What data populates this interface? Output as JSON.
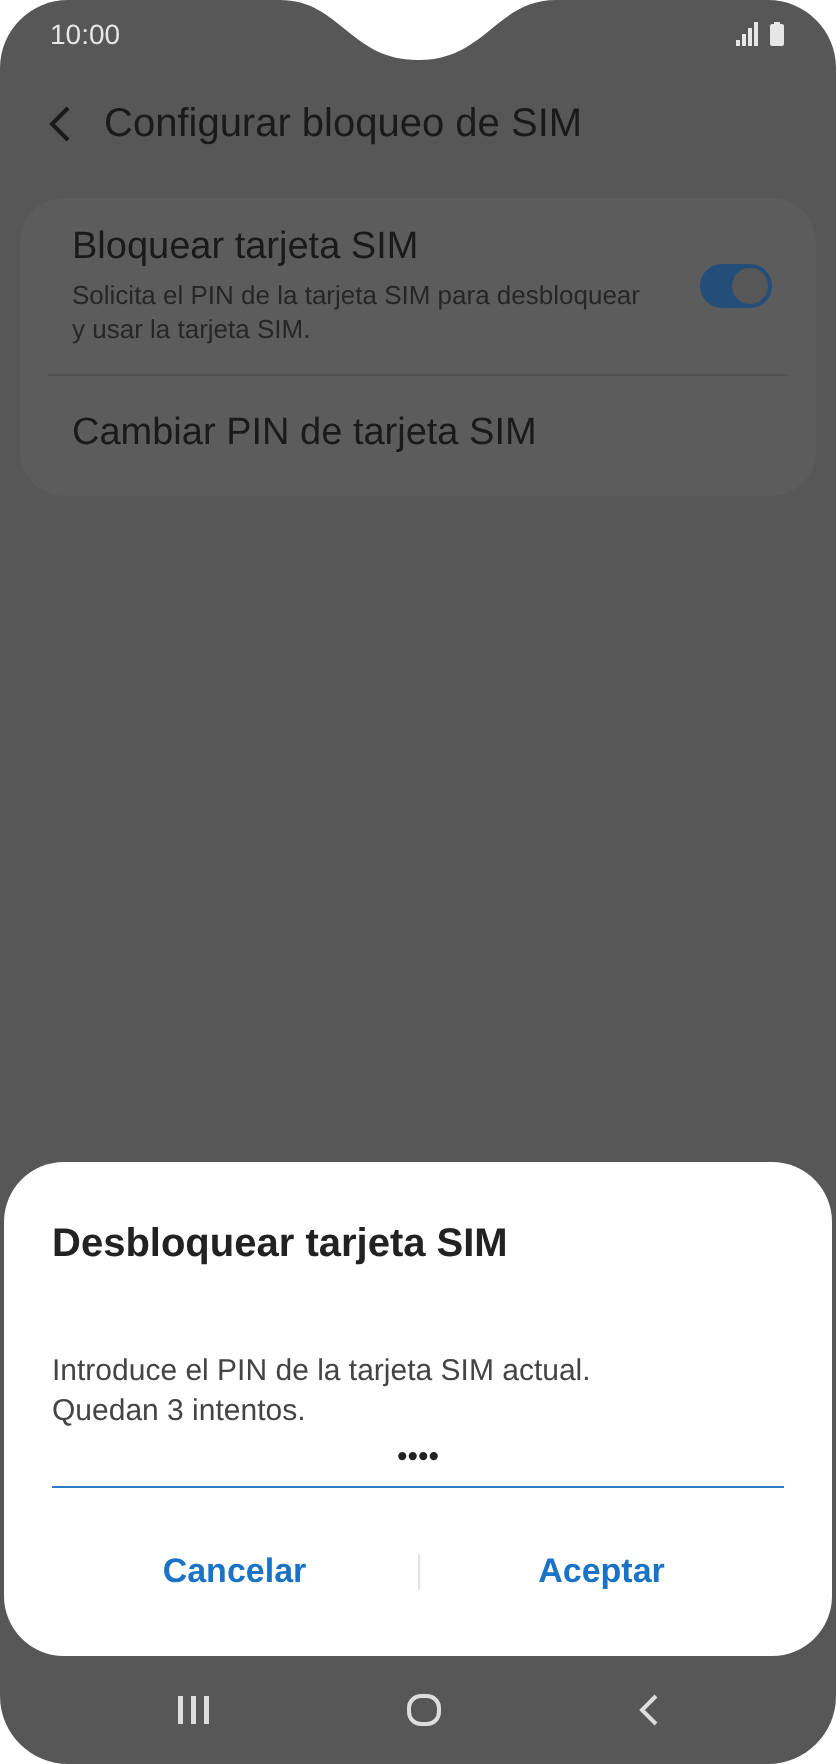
{
  "status_bar": {
    "time": "10:00"
  },
  "header": {
    "title": "Configurar bloqueo de SIM"
  },
  "settings": [
    {
      "kind": "switch",
      "title": "Bloquear tarjeta SIM",
      "subtitle": "Solicita el PIN de la tarjeta SIM para desbloquear y usar la tarjeta SIM.",
      "on": true
    },
    {
      "kind": "plain",
      "title": "Cambiar PIN de tarjeta SIM"
    }
  ],
  "dialog": {
    "title": "Desbloquear tarjeta SIM",
    "message": "Introduce el PIN de la tarjeta SIM actual.\nQuedan 3 intentos.",
    "pin": {
      "value": "••••"
    },
    "buttons": [
      "Cancelar",
      "Aceptar"
    ]
  }
}
